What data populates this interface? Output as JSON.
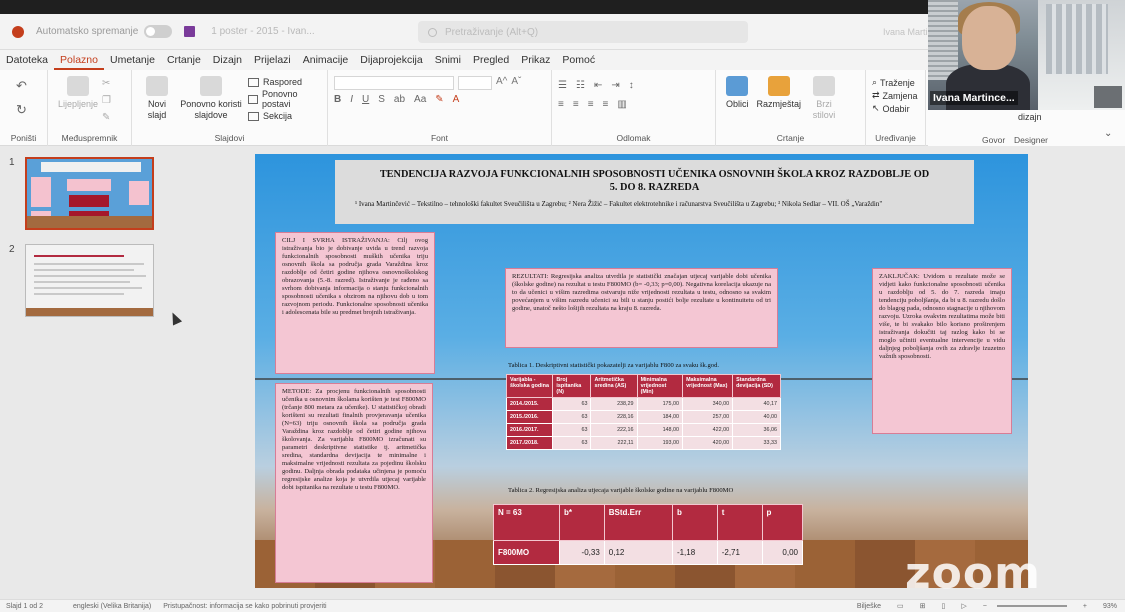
{
  "titlebar": {
    "autosave": "Automatsko spremanje",
    "filename": "1 poster - 2015 - Ivan...",
    "search_placeholder": "Pretraživanje (Alt+Q)",
    "user": "Ivana Martinc..."
  },
  "menu": [
    "Datoteka",
    "Polazno",
    "Umetanje",
    "Crtanje",
    "Dizajn",
    "Prijelazi",
    "Animacije",
    "Dijaprojekcija",
    "Snimi",
    "Pregled",
    "Prikaz",
    "Pomoć"
  ],
  "ribbon": {
    "undo_label": "Poništi",
    "clipboard_label": "Međuspremnik",
    "paste": "Lijepljenje",
    "new_slide": "Novi slajd",
    "reuse": "Ponovno koristi slajdove",
    "layout": "Raspored",
    "reset": "Ponovno postavi",
    "section": "Sekcija",
    "slides_label": "Slajdovi",
    "font_label": "Font",
    "paragraph_label": "Odlomak",
    "shapes": "Oblici",
    "arrange": "Razmještaj",
    "quick_styles": "Brzi stilovi",
    "drawing_label": "Crtanje",
    "find": "Traženje",
    "replace": "Zamjena",
    "select": "Odabir",
    "editing_label": "Uređivanje",
    "voice_label": "Govor",
    "designer": "dizajn",
    "designer_label": "Designer"
  },
  "webcam": {
    "name": "Ivana Martince..."
  },
  "thumbnails": [
    {
      "num": "1"
    },
    {
      "num": "2"
    }
  ],
  "slide": {
    "title": "TENDENCIJA RAZVOJA FUNKCIONALNIH SPOSOBNOSTI UČENIKA OSNOVNIH ŠKOLA KROZ RAZDOBLJE OD 5. DO 8. RAZREDA",
    "authors": "¹ Ivana Martinčević – Tekstilno – tehnološki fakultet Sveučilišta u Zagrebu; ² Nera Žižić – Fakultet elektrotehnike i računarstva Sveučilišta u Zagrebu; ³ Nikola Sedlar – VII. OŠ „Varaždin\"",
    "cilj": "CILJ I SVRHA ISTRAŽIVANJA: Cilj ovog istraživanja bio je dobivanje uvida u trend razvoja funkcionalnih sposobnosti muških učenika triju osnovnih škola sa područja grada Varaždina kroz razdoblje od četiri godine njihova osnovnoškolskog obrazovanja (5.-8. razred). Istraživanje je rađeno sa svrhom dobivanja informacija o stanju funkcionalnih sposobnosti učenika s obzirom na njihovu dob u tom razvojnom periodu. Funkcionalne sposobnosti učenika i adolescenata bile su predmet brojnih istraživanja.",
    "metode": "METODE: Za procjenu funkcionalnih sposobnosti učenika u osnovnim školama korišten je test F800MO (trčanje 800 metara za učenike). U statističkoj obradi korišteni su rezultati finalnih provjeravanja učenika (N=63) triju osnovnih škola sa područja grada Varaždina kroz razdoblje od četiri godine njihova školovanja. Za varijablu F800MO izračunati su parametri deskriptivne statistike tj. aritmetička sredina, standardna devijacija te minimalne i maksimalne vrijednosti rezultata za pojedinu školsku godinu. Daljnja obrada podataka učinjena je pomoću regresijske analize koja je utvrdila utjecaj varijable dobi ispitanika na rezultate u testu F800MO.",
    "rezultati": "REZULTATI: Regresijska analiza utvrdila je statistički značajan utjecaj varijable dobi učenika (školske godine) na rezultat u testu F800MO (b= -0,33; p=0,00). Negativna korelacija ukazuje na to da učenici u višim razredima ostvaruju niže vrijednosti rezultata u testu, odnosno sa svakim povećanjem u višim razredu učenici su bili u stanju postići bolje rezultate u kontinuitetu od tri godine, unatoč nešto lošijih rezultata na kraju 8. razreda.",
    "zakljucak": "ZAKLJUČAK: Uvidom u rezultate može se vidjeti kako funkcionalne sposobnosti učenika u razdoblju od 5. do 7. razreda imaju tendenciju poboljšanja, da bi u 8. razredu došlo do blagog pada, odnosno stagnacije u njihovom razvoju. Uzroka ovakvim rezultatima može biti više, te bi svakako bilo korisno proširenjem istraživanja dokučiti taj razlog kako bi se moglo učiniti eventualne intervencije u vidu daljnjeg poboljšanja ovih za zdravlje izuzetno važnih sposobnosti.",
    "table1_caption": "Tablica 1. Deskriptivni statistički pokazatelji za varijablu F800 za svaku šk.god.",
    "table1_headers": [
      "Varijabla - školska godina",
      "Broj ispitanika (N)",
      "Aritmetička sredina (AS)",
      "Minimalna vrijednost (Min)",
      "Maksimalna vrijednost (Max)",
      "Standardna devijacija (SD)"
    ],
    "table1_rows": [
      [
        "2014./2015.",
        "63",
        "238,29",
        "175,00",
        "340,00",
        "40,17"
      ],
      [
        "2015./2016.",
        "63",
        "228,16",
        "184,00",
        "257,00",
        "40,00"
      ],
      [
        "2016./2017.",
        "63",
        "222,16",
        "148,00",
        "422,00",
        "36,06"
      ],
      [
        "2017./2018.",
        "63",
        "222,11",
        "193,00",
        "420,00",
        "33,33"
      ]
    ],
    "table2_caption": "Tablica 2. Regresijska analiza utjecaja varijable školske godine na varijablu F800MO",
    "table2_headers": [
      "N = 63",
      "b*",
      "BStd.Err",
      "b",
      "t",
      "p"
    ],
    "table2_row": [
      "F800MO",
      "-0,33",
      "0,12",
      "-1,18",
      "-2,71",
      "0,00"
    ]
  },
  "zoom_watermark": "zoom",
  "statusbar": {
    "slide": "Slajd 1 od 2",
    "lang": "engleski (Velika Britanija)",
    "accessibility": "Pristupačnost: informacija se kako pobrinuti provjeriti",
    "notes": "Bilješke",
    "zoom": "93%"
  }
}
